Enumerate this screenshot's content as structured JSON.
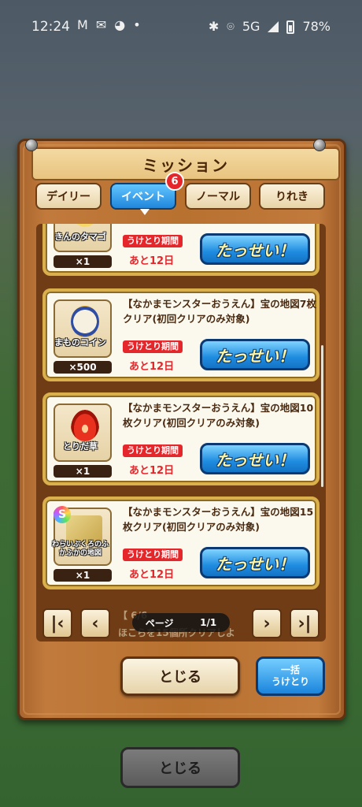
{
  "status_bar": {
    "time": "12:24",
    "left_icons": [
      "gmail-icon",
      "mail-icon",
      "app-icon",
      "dot-icon"
    ],
    "network": "5G",
    "battery": "78%"
  },
  "dialog": {
    "title": "ミッション",
    "tabs": [
      {
        "label": "デイリー",
        "active": false
      },
      {
        "label": "イベント",
        "active": true,
        "badge": "6"
      },
      {
        "label": "ノーマル",
        "active": false
      },
      {
        "label": "りれき",
        "active": false
      }
    ],
    "missions": [
      {
        "item_name": "きんのタマゴ",
        "qty": "×1",
        "desc": "",
        "period_label": "うけとり期間",
        "remain": "あと12日",
        "button": "たっせい！"
      },
      {
        "item_name": "まものコイン",
        "qty": "×500",
        "desc": "【なかまモンスターおうえん】宝の地図7枚クリア(初回クリアのみ対象)",
        "period_label": "うけとり期間",
        "remain": "あと12日",
        "button": "たっせい！"
      },
      {
        "item_name": "とりだ草",
        "qty": "×1",
        "desc": "【なかまモンスターおうえん】宝の地図10枚クリア(初回クリアのみ対象)",
        "period_label": "うけとり期間",
        "remain": "あと12日",
        "button": "たっせい！"
      },
      {
        "item_name": "わらいぶくろのふかふかの地図",
        "qty": "×1",
        "desc": "【なかまモンスターおうえん】宝の地図15枚クリア(初回クリアのみ対象)",
        "period_label": "うけとり期間",
        "remain": "あと12日",
        "button": "たっせい！"
      }
    ],
    "pager": {
      "page_label": "ページ",
      "page_value": "1/1",
      "behind_text_1": "【",
      "behind_text_2": "6/6",
      "behind_text_3": "ほこらを15個所クリアしよ"
    },
    "close_label": "とじる",
    "bulk_line1": "一括",
    "bulk_line2": "うけとり"
  },
  "outer_close_label": "とじる"
}
